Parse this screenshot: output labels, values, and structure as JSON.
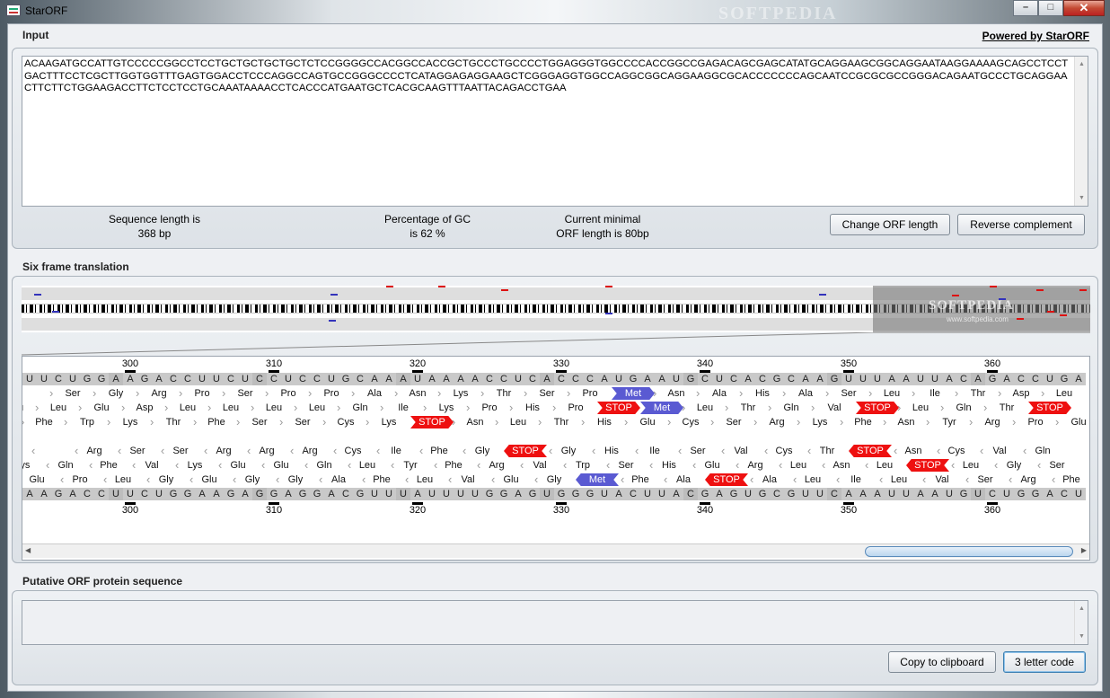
{
  "window": {
    "title": "StarORF",
    "watermark": "SOFTPEDIA",
    "minimize_glyph": "–",
    "maximize_glyph": "□",
    "close_glyph": "✕"
  },
  "input": {
    "section_label": "Input",
    "powered_by": "Powered by StarORF",
    "sequence": "ACAAGATGCCATTGTCCCCCGGCCTCCTGCTGCTGCTGCTCTCCGGGGCCACGGCCACCGCTGCCCTGCCCCTGGAGGGTGGCCCCACCGGCCGAGACAGCGAGCATATGCAGGAAGCGGCAGGAATAAGGAAAAGCAGCCTCCTGACTTTCCTCGCTTGGTGGTTTGAGTGGACCTCCCAGGCCAGTGCCGGGCCCCTCATAGGAGAGGAAGCTCGGGAGGTGGCCAGGCGGCAGGAAGGCGCACCCCCCCAGCAATCCGCGCGCCGGGACAGAATGCCCTGCAGGAACTTCTTCTGGAAGACCTTCTCCTCCTGCAAATAAAACCTCACCCATGAATGCTCACGCAAGTTTAATTACAGACCTGAA",
    "seq_length_label": "Sequence length is",
    "seq_length_value": "368 bp",
    "gc_label": "Percentage of GC",
    "gc_value": "is 62 %",
    "orf_label": "Current minimal",
    "orf_value": "ORF length is 80bp",
    "change_orf_button": "Change ORF length",
    "reverse_button": "Reverse complement"
  },
  "translation": {
    "section_label": "Six frame translation",
    "overview_watermark": "SOFTPEDIA",
    "overview_watermark_url": "www.softpedia.com",
    "ruler_top": [
      "300",
      "310",
      "320",
      "330",
      "340",
      "350",
      "360"
    ],
    "ruler_bottom": [
      "300",
      "310",
      "320",
      "330",
      "340",
      "350",
      "360"
    ],
    "top_strand": "UUCUGGAAGACCUUCUCCUCCUGCAAAUAAAACCUCACCCAUGAAUGCUCACGCAAGUUUAAUUACAGACCUGA",
    "bottom_strand": "AAGACCUUCUGGAAGAGGAGGACGUUUAUUUUGGAGUGGGUACUUACGAGUGCGUUCAAAUUAAUGUCUGGACU",
    "frames_forward": [
      [
        "",
        "Ser",
        "Gly",
        "Arg",
        "Pro",
        "Ser",
        "Pro",
        "Pro",
        "Ala",
        "Asn",
        "Lys",
        "Thr",
        "Ser",
        "Pro",
        "Met",
        "Asn",
        "Ala",
        "His",
        "Ala",
        "Ser",
        "Leu",
        "Ile",
        "Thr",
        "Asp",
        "Leu"
      ],
      [
        "Leu",
        "Leu",
        "Glu",
        "Asp",
        "Leu",
        "Leu",
        "Leu",
        "Leu",
        "Gln",
        "Ile",
        "Lys",
        "Pro",
        "His",
        "Pro",
        "STOP",
        "Met",
        "Leu",
        "Thr",
        "Gln",
        "Val",
        "STOP",
        "Leu",
        "Gln",
        "Thr",
        "STOP"
      ],
      [
        "Phe",
        "Trp",
        "Lys",
        "Thr",
        "Phe",
        "Ser",
        "Ser",
        "Cys",
        "Lys",
        "STOP",
        "Asn",
        "Leu",
        "Thr",
        "His",
        "Glu",
        "Cys",
        "Ser",
        "Arg",
        "Lys",
        "Phe",
        "Asn",
        "Tyr",
        "Arg",
        "Pro",
        "Glu"
      ]
    ],
    "frames_reverse": [
      [
        "",
        "Arg",
        "Ser",
        "Ser",
        "Arg",
        "Arg",
        "Arg",
        "Cys",
        "Ile",
        "Phe",
        "Gly",
        "STOP",
        "Gly",
        "His",
        "Ile",
        "Ser",
        "Val",
        "Cys",
        "Thr",
        "STOP",
        "Asn",
        "Cys",
        "Val",
        "Gln"
      ],
      [
        "Lys",
        "Gln",
        "Phe",
        "Val",
        "Lys",
        "Glu",
        "Glu",
        "Gln",
        "Leu",
        "Tyr",
        "Phe",
        "Arg",
        "Val",
        "Trp",
        "Ser",
        "His",
        "Glu",
        "Arg",
        "Leu",
        "Asn",
        "Leu",
        "STOP",
        "Leu",
        "Gly",
        "Ser"
      ],
      [
        "Glu",
        "Pro",
        "Leu",
        "Gly",
        "Glu",
        "Gly",
        "Gly",
        "Ala",
        "Phe",
        "Leu",
        "Val",
        "Glu",
        "Gly",
        "Met",
        "Phe",
        "Ala",
        "STOP",
        "Ala",
        "Leu",
        "Ile",
        "Leu",
        "Val",
        "Ser",
        "Arg",
        "Phe"
      ]
    ]
  },
  "protein": {
    "section_label": "Putative ORF protein sequence",
    "output": "",
    "copy_button": "Copy to clipboard",
    "code_button": "3 letter code"
  },
  "colors": {
    "stop": "#ee1010",
    "met": "#5a5ad2",
    "nucleotide_bg": "#c9c9c9",
    "watermark": "#ffffff"
  },
  "icons": {
    "app": "staroRF-app-icon",
    "close": "close-icon",
    "minimize": "minimize-icon",
    "maximize": "maximize-icon"
  }
}
